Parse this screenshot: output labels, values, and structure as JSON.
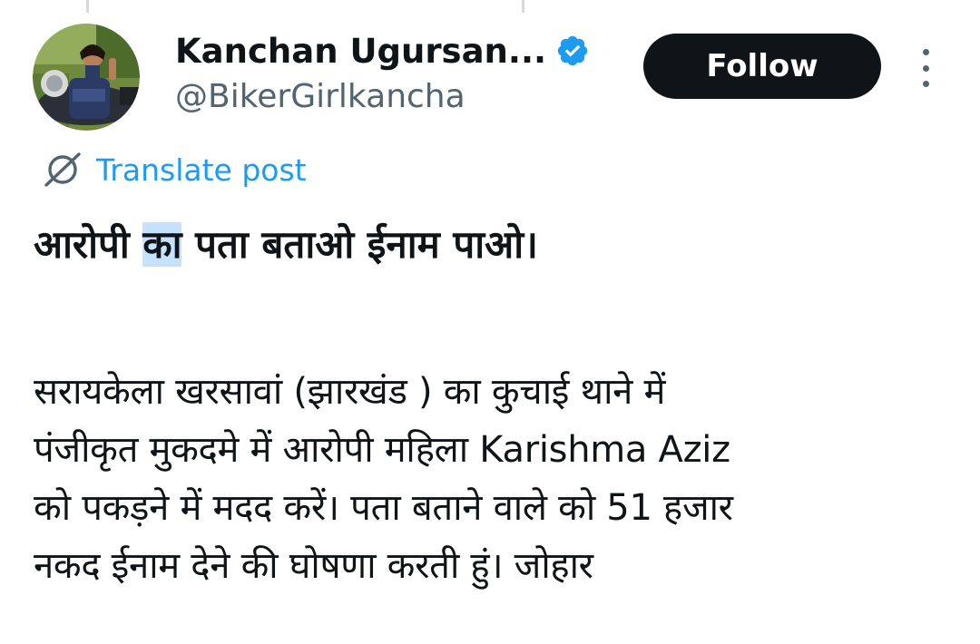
{
  "author": {
    "name": "Kanchan Ugursan...",
    "handle": "@BikerGirlkancha",
    "verified": true,
    "avatar_icon": "profile-photo-rider-on-motorcycle"
  },
  "actions": {
    "follow_label": "Follow",
    "more_icon": "more-vertical-icon"
  },
  "translate": {
    "label": "Translate post",
    "icon": "translate-globe-icon",
    "color": "#1d9bf0"
  },
  "post": {
    "headline_before": "आरोपी ",
    "headline_selected": "का",
    "headline_after": " पता बताओ ईनाम पाओ।",
    "body_lines": [
      "सरायकेला खरसावां (झारखंड ) का कुचाई थाने में",
      "पंजीकृत मुकदमे में आरोपी महिला Karishma Aziz",
      "को पकड़ने में मदद करें। पता बताने वाले को 51 हजार",
      "नकद ईनाम देने की घोषणा करती हुं। जोहार"
    ]
  },
  "colors": {
    "text": "#0f1419",
    "secondary": "#536471",
    "accent": "#1d9bf0",
    "button_bg": "#0f1419",
    "selection": "#c5e3ff"
  }
}
